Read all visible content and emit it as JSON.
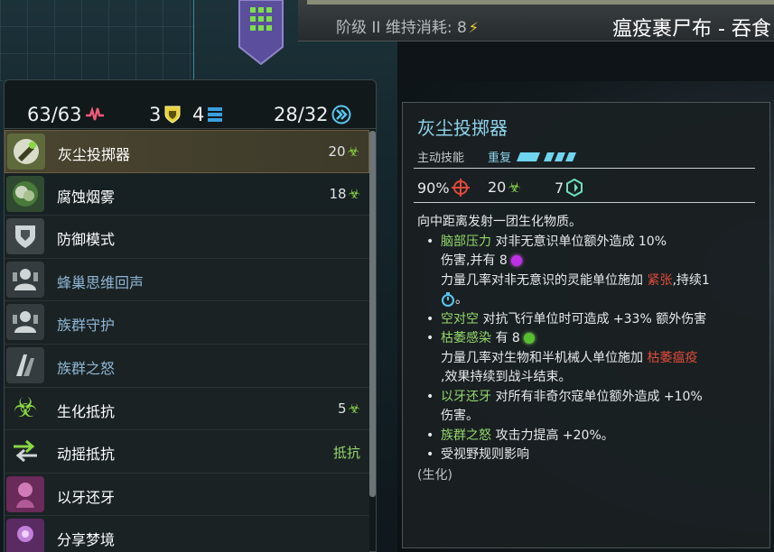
{
  "topbar": {
    "upkeep_label": "阶级 II 维持消耗: 8",
    "unit_name": "瘟疫裹尸布 - 吞食"
  },
  "stats": {
    "health": "63/63",
    "armor": "3",
    "shield": "4",
    "moves": "28/32"
  },
  "abilities": [
    {
      "label": "灰尘投掷器",
      "cost": "20",
      "selected": true,
      "dim": false
    },
    {
      "label": "腐蚀烟雾",
      "cost": "18",
      "selected": false,
      "dim": false
    },
    {
      "label": "防御模式",
      "cost": "",
      "selected": false,
      "dim": false
    },
    {
      "label": "蜂巢思维回声",
      "cost": "",
      "selected": false,
      "dim": true
    },
    {
      "label": "族群守护",
      "cost": "",
      "selected": false,
      "dim": true
    },
    {
      "label": "族群之怒",
      "cost": "",
      "selected": false,
      "dim": true
    },
    {
      "label": "生化抵抗",
      "cost": "5",
      "selected": false,
      "dim": false
    },
    {
      "label": "动摇抵抗",
      "cost": "抵抗",
      "selected": false,
      "dim": false
    },
    {
      "label": "以牙还牙",
      "cost": "",
      "selected": false,
      "dim": false
    },
    {
      "label": "分享梦境",
      "cost": "",
      "selected": false,
      "dim": false
    }
  ],
  "tooltip": {
    "title": "灰尘投掷器",
    "type": "主动技能",
    "repeat": "重复",
    "accuracy": "90%",
    "damage": "20",
    "range": "7",
    "description": "向中距离发射一团生化物质。",
    "b1_name": "脑部压力",
    "b1_text": " 对非无意识单位额外造成 10%",
    "b1_line2a": "伤害,并有 8 ",
    "b1_line3a": "力量几率对非无意识的灵能单位施加 ",
    "b1_status": "紧张",
    "b1_line3b": ",持续1",
    "b1_line4": "。",
    "b2_name": "空对空",
    "b2_text": " 对抗飞行单位时可造成 +33% 额外伤害",
    "b3_name": "枯萎感染",
    "b3_text": " 有 8",
    "b3_line2a": "力量几率对生物和半机械人单位施加 ",
    "b3_status": "枯萎瘟疫",
    "b3_line3": ",效果持续到战斗结束。",
    "b4_name": "以牙还牙",
    "b4_text": " 对所有非奇尔寇单位额外造成 +10%",
    "b4_line2": "伤害。",
    "b5_name": "族群之怒",
    "b5_text": " 攻击力提高 +20%。",
    "b6_text": "受视野规则影响",
    "footer": "(生化)"
  },
  "colors": {
    "accent_cyan": "#8fd3ea",
    "keyword_green": "#94d76a",
    "status_red": "#e04a3a",
    "biohazard_green": "#8ad645"
  }
}
